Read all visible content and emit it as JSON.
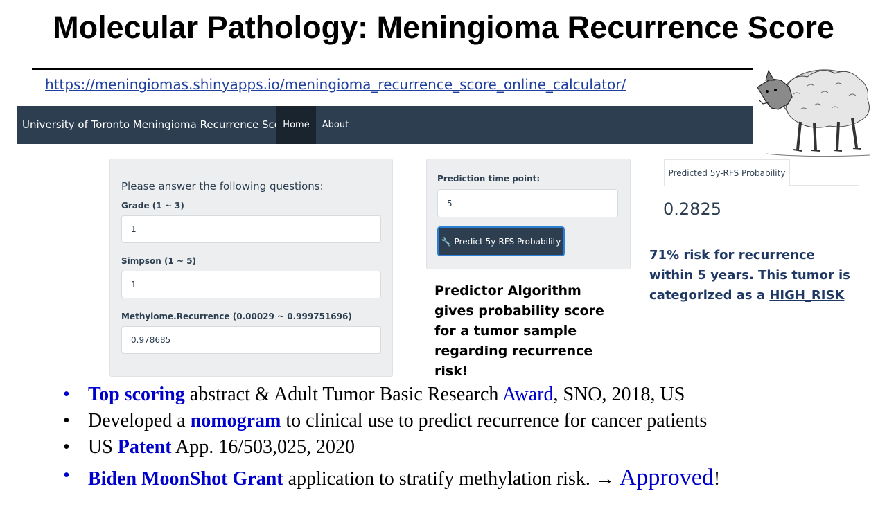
{
  "slide": {
    "title": "Molecular Pathology: Meningioma Recurrence Score",
    "url": "https://meningiomas.shinyapps.io/meningioma_recurrence_score_online_calculator/"
  },
  "navbar": {
    "brand": "University of Toronto Meningioma Recurrence Score",
    "home": "Home",
    "about": "About"
  },
  "form": {
    "intro": "Please answer the following questions:",
    "grade_label": "Grade (1 ~ 3)",
    "grade_value": "1",
    "simpson_label": "Simpson (1 ~ 5)",
    "simpson_value": "1",
    "methylome_label": "Methylome.Recurrence (0.00029 ~ 0.999751696)",
    "methylome_value": "0.978685"
  },
  "prediction": {
    "time_label": "Prediction time point:",
    "time_value": "5",
    "button_label": "Predict 5y-RFS Probability",
    "tab_label": "Predicted 5y-RFS Probability",
    "score": "0.2825"
  },
  "notes": {
    "algorithm": "Predictor Algorithm gives probability score for a tumor sample regarding recurrence risk!",
    "risk_text": "71% risk for recurrence within 5 years. This tumor is categorized as a",
    "risk_link": "HIGH_RISK"
  },
  "bullets": {
    "b1_highlight": "Top scoring",
    "b1_text": " abstract & Adult Tumor Basic Research ",
    "b1_award": "Award",
    "b1_tail": ", SNO, 2018, US",
    "b2_start": "Developed a ",
    "b2_highlight": "nomogram",
    "b2_tail": " to clinical use to predict recurrence for cancer patients",
    "b3_start": "US ",
    "b3_highlight": "Patent",
    "b3_tail": " App. 16/503,025, 2020",
    "b4_highlight": "Biden MoonShot Grant",
    "b4_text": " application to stratify methylation risk. → ",
    "b4_approved": "Approved",
    "b4_tail": "!"
  },
  "colors": {
    "navbar": "#2c3e50",
    "accent_blue": "#0000cc",
    "risk_text": "#1f3864"
  },
  "icons": {
    "wolf_image": "wolf-in-sheep-clothing-illustration",
    "button_icon": "wrench-icon"
  }
}
